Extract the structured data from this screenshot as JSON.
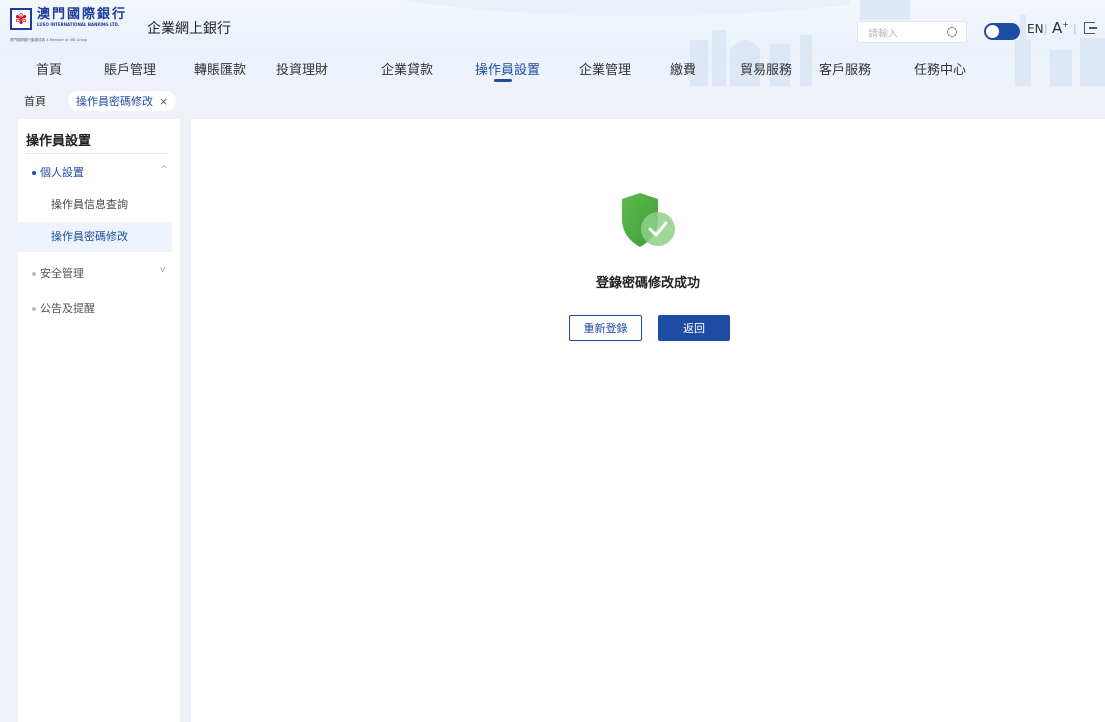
{
  "header": {
    "logo_cn": "澳門國際銀行",
    "logo_en": "LUSO INTERNATIONAL BANKING LTD.",
    "logo_sub": "廈門國際銀行集團成員 A Member of XIB Group",
    "app_title": "企業網上銀行",
    "search_placeholder": "請輸入",
    "lang": "EN",
    "font_size_label": "A",
    "font_size_sup": "+"
  },
  "nav": {
    "items": [
      "首頁",
      "賬戶管理",
      "轉賬匯款",
      "投資理財",
      "企業貸款",
      "操作員設置",
      "企業管理",
      "繳費",
      "貿易服務",
      "客戶服務",
      "任務中心"
    ],
    "active_index": 5
  },
  "breadcrumb": {
    "home": "首頁",
    "tab": "操作員密碼修改",
    "close": "×"
  },
  "sidebar": {
    "title": "操作員設置",
    "groups": [
      {
        "label": "個人設置",
        "expanded": true,
        "children": [
          "操作員信息查詢",
          "操作員密碼修改"
        ],
        "active_child": 1
      },
      {
        "label": "安全管理",
        "expanded": false
      },
      {
        "label": "公告及提醒",
        "expanded": false
      }
    ],
    "chevron_up": "^",
    "chevron_down": "v"
  },
  "main": {
    "success_message": "登錄密碼修改成功",
    "relogin_button": "重新登錄",
    "back_button": "返回"
  },
  "colors": {
    "primary": "#1f4ca3",
    "success": "#4caf50"
  }
}
